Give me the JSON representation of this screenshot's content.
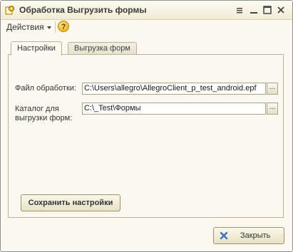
{
  "window": {
    "title": "Обработка  Выгрузить формы"
  },
  "toolbar": {
    "actions_label": "Действия",
    "help_label": "?"
  },
  "tabs": [
    {
      "label": "Настройки",
      "active": true
    },
    {
      "label": "Выгрузка форм",
      "active": false
    }
  ],
  "settings": {
    "file_label": "Файл обработки:",
    "file_value": "C:\\Users\\allegro\\AllegroClient_p_test_android.epf",
    "dir_label_line1": "Каталог для",
    "dir_label_line2": "выгрузки форм:",
    "dir_value": "C:\\_Test\\Формы",
    "browse_label": "...",
    "save_button": "Сохранить настройки"
  },
  "footer": {
    "close_button": "Закрыть"
  }
}
